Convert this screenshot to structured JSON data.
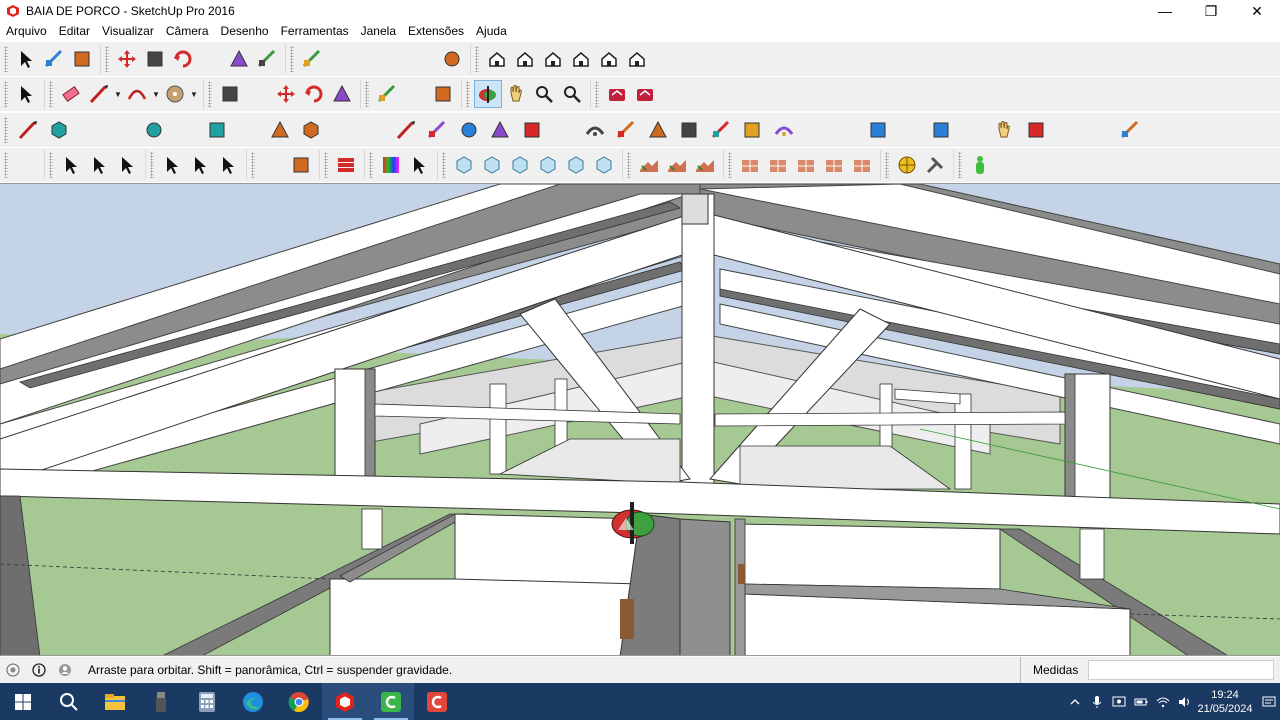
{
  "window": {
    "title": "BAIA DE PORCO - SketchUp Pro 2016",
    "minimize_glyph": "—",
    "maximize_glyph": "❐",
    "close_glyph": "✕"
  },
  "menu": [
    "Arquivo",
    "Editar",
    "Visualizar",
    "Câmera",
    "Desenho",
    "Ferramentas",
    "Janela",
    "Extensões",
    "Ajuda"
  ],
  "toolbars": {
    "row1": [
      [
        "select-icon",
        "component-icon",
        "paint-bucket-icon"
      ],
      [
        "move-icon",
        "push-pull-icon",
        "rotate-icon",
        "follow-me-icon",
        "scale-icon",
        "offset-icon"
      ],
      [
        "tape-measure-icon",
        "dimension-icon",
        "protractor-icon",
        "text-icon",
        "axes-icon",
        "3d-text-icon"
      ],
      [
        "iso-view-icon",
        "top-view-icon",
        "front-view-icon",
        "right-view-icon",
        "back-view-icon",
        "left-view-icon"
      ]
    ],
    "row2": [
      [
        "select-icon"
      ],
      [
        "eraser-icon",
        "line-icon",
        "arc-icon",
        "circle-icon"
      ],
      [
        "push-pull-icon",
        "follow-me-icon",
        "move-icon",
        "rotate-icon",
        "scale-icon"
      ],
      [
        "tape-measure-icon",
        "text-icon",
        "paint-bucket-icon"
      ],
      [
        "orbit-icon",
        "pan-icon",
        "zoom-icon",
        "zoom-extents-icon"
      ],
      [
        "warehouse-icon",
        "extension-warehouse-icon"
      ]
    ],
    "row3_count": 37,
    "row4": [
      [
        "section-plane-icon"
      ],
      [
        "blue-select-icon-1",
        "blue-select-icon-2",
        "blue-select-icon-3"
      ],
      [
        "blue-select-icon-4",
        "blue-select-icon-5",
        "blue-select-icon-6"
      ],
      [
        "sun-icon",
        "style-icon"
      ],
      [
        "layer-icon"
      ],
      [
        "color-grid-icon",
        "select-arrow-icon"
      ],
      [
        "solid-icon-1",
        "solid-icon-2",
        "solid-icon-3",
        "solid-icon-4",
        "solid-icon-5",
        "solid-icon-6"
      ],
      [
        "sandbox-icon-1",
        "sandbox-icon-2",
        "sandbox-icon-3"
      ],
      [
        "terrain-icon-1",
        "terrain-icon-2",
        "terrain-icon-3",
        "terrain-icon-4",
        "terrain-icon-5"
      ],
      [
        "location-icon",
        "tools-icon"
      ],
      [
        "person-icon"
      ]
    ],
    "active_tool": "orbit-icon"
  },
  "status": {
    "text": "Arraste para orbitar. Shift = panorâmica, Ctrl = suspender gravidade.",
    "measure_label": "Medidas",
    "measure_value": ""
  },
  "taskbar": {
    "apps": [
      "start-icon",
      "search-icon",
      "file-explorer-icon",
      "usb-icon",
      "calculator-icon",
      "edge-icon",
      "chrome-icon",
      "sketchup-icon",
      "camtasia-green-icon",
      "camtasia-red-icon"
    ],
    "active_app": "sketchup-icon",
    "time": "19:24",
    "date": "21/05/2024"
  },
  "colors": {
    "sky": "#c4d3e6",
    "ground": "#a6c893",
    "timber": "#ffffff",
    "shadow": "#7c7c7c",
    "taskbar": "#1b3a63"
  }
}
